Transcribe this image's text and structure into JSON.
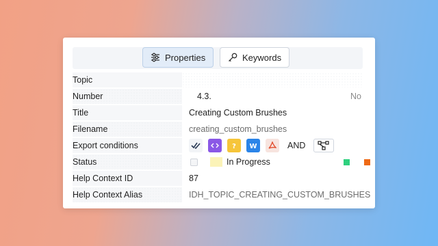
{
  "tabs": {
    "properties_label": "Properties",
    "keywords_label": "Keywords"
  },
  "rows": {
    "topic": {
      "label": "Topic"
    },
    "number": {
      "label": "Number",
      "value": "4.3.",
      "suffix": "No"
    },
    "title": {
      "label": "Title",
      "value": "Creating Custom Brushes"
    },
    "filename": {
      "label": "Filename",
      "value": "creating_custom_brushes"
    },
    "export": {
      "label": "Export conditions",
      "and_label": "AND",
      "icons": [
        "check-all-icon",
        "code-icon",
        "help-icon",
        "word-icon",
        "pdf-icon",
        "tree-icon"
      ]
    },
    "status": {
      "label": "Status",
      "value": "In Progress",
      "colors": {
        "swatch": "#fbf3b8",
        "green": "#2fd07e",
        "orange": "#ee6a16"
      }
    },
    "help_id": {
      "label": "Help Context ID",
      "value": "87"
    },
    "help_alias": {
      "label": "Help Context Alias",
      "value": "IDH_TOPIC_CREATING_CUSTOM_BRUSHES"
    }
  }
}
